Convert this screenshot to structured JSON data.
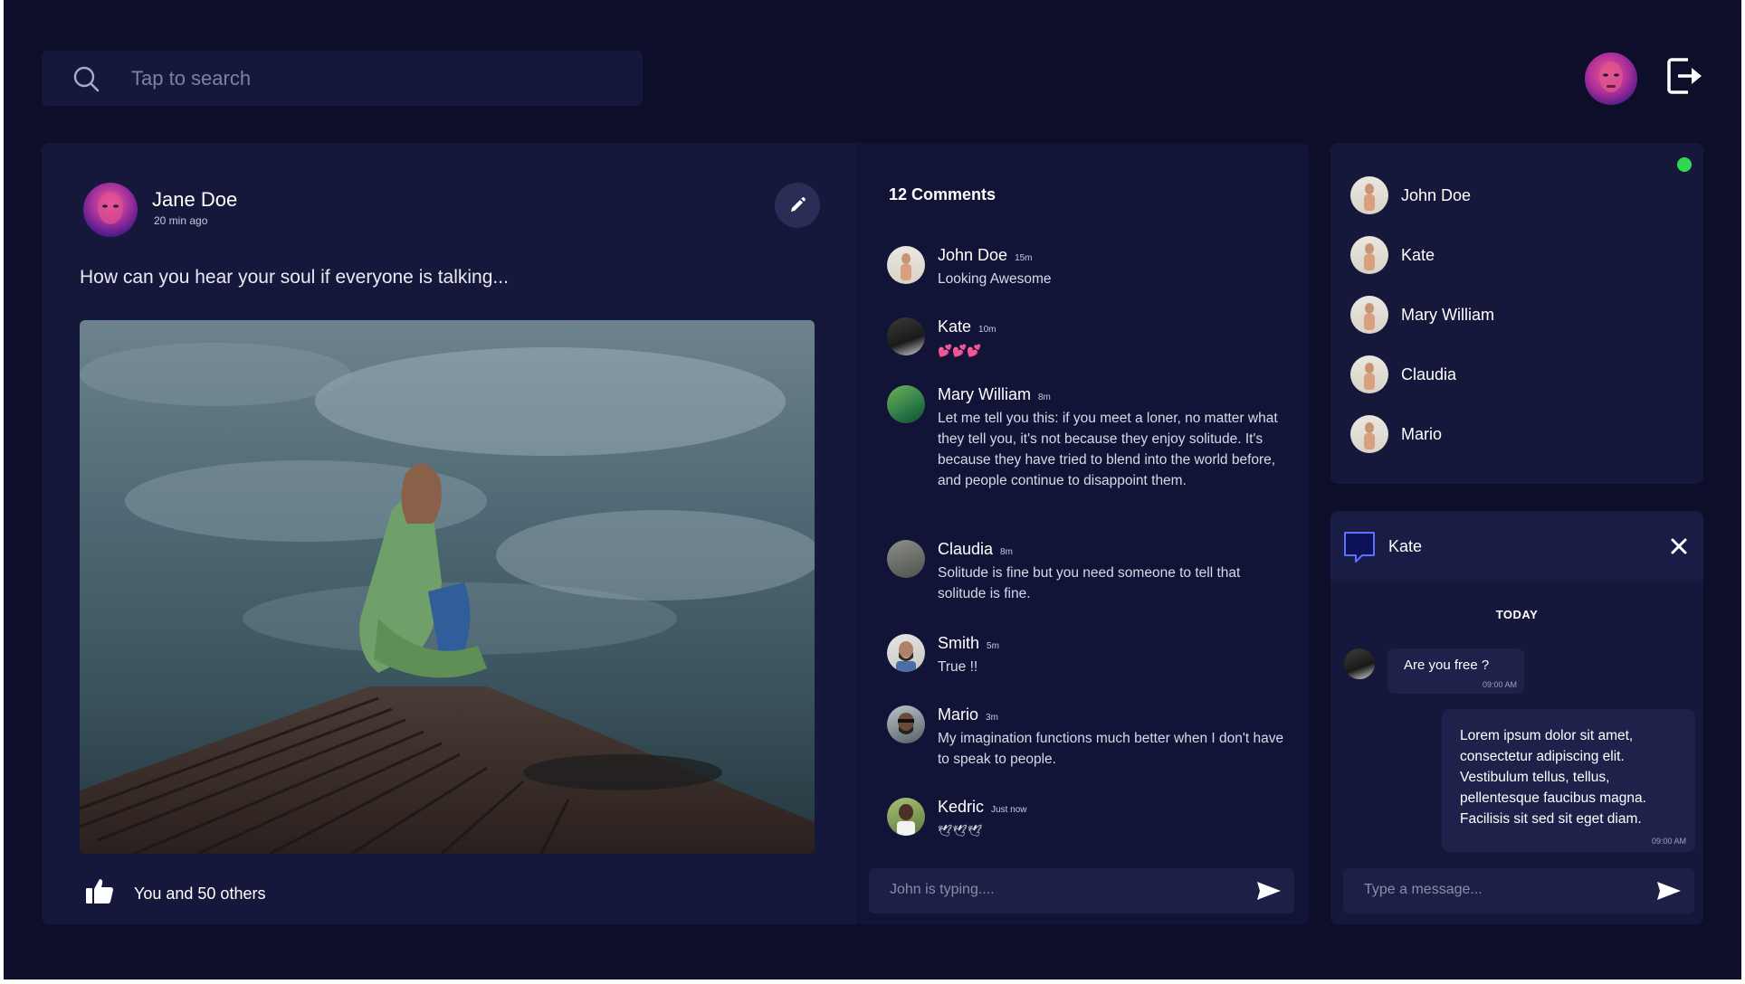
{
  "search": {
    "placeholder": "Tap to search",
    "icon": "search-icon"
  },
  "header": {
    "avatar": "avatar-jane",
    "logout_icon": "logout-icon"
  },
  "post": {
    "author": "Jane Doe",
    "time": "20 min ago",
    "text": "How can you hear your soul if everyone is talking...",
    "likes_text": "You and 50 others"
  },
  "comments": {
    "title": "12 Comments",
    "items": [
      {
        "name": "John Doe",
        "time": "15m",
        "text": "Looking Awesome"
      },
      {
        "name": "Kate",
        "time": "10m",
        "text": "💕💕💕"
      },
      {
        "name": "Mary William",
        "time": "8m",
        "text": "Let me tell you this: if you meet a loner, no matter what they tell you, it's not because they enjoy solitude. It's because they have tried to blend into the world before, and people continue to disappoint them."
      },
      {
        "name": "Claudia",
        "time": "8m",
        "text": "Solitude is fine but you need someone to tell that solitude is fine."
      },
      {
        "name": "Smith",
        "time": "5m",
        "text": "True !!"
      },
      {
        "name": "Mario",
        "time": "3m",
        "text": "My imagination functions much better when I don't have to speak to people."
      },
      {
        "name": "Kedric",
        "time": "Just now",
        "text": "🕊🕊🕊"
      }
    ],
    "typing_placeholder": "John is typing...."
  },
  "friends": {
    "items": [
      {
        "name": "John Doe"
      },
      {
        "name": "Kate"
      },
      {
        "name": "Mary William"
      },
      {
        "name": "Claudia"
      },
      {
        "name": "Mario"
      }
    ],
    "online_color": "#2fd84e"
  },
  "chat": {
    "name": "Kate",
    "day": "TODAY",
    "messages": [
      {
        "text": "Are you free ?",
        "time": "09:00 AM"
      },
      {
        "text": "Lorem ipsum dolor sit amet, consectetur adipiscing elit. Vestibulum tellus, tellus, pellentesque faucibus magna. Facilisis sit sed sit eget diam.",
        "time": "09:00 AM"
      }
    ],
    "input_placeholder": "Type a message..."
  },
  "colors": {
    "background": "#0c0e2a",
    "panel": "#15183a",
    "accent": "#2a2d55"
  }
}
